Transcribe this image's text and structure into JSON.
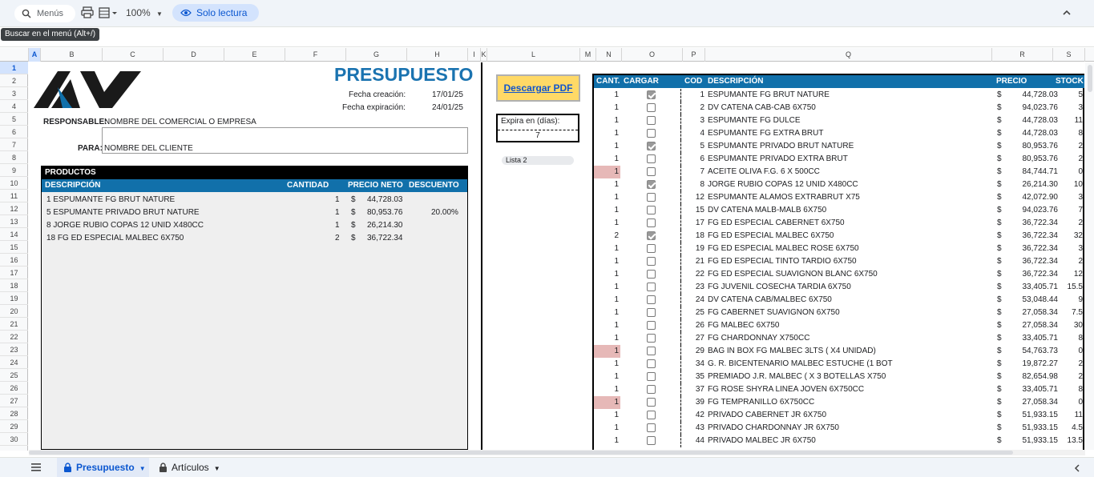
{
  "toolbar": {
    "search_placeholder": "Menús",
    "zoom": "100%",
    "readonly_label": "Solo lectura"
  },
  "tooltip": "Buscar en el menú (Alt+/)",
  "columns": [
    "A",
    "B",
    "C",
    "D",
    "E",
    "F",
    "G",
    "H",
    "I",
    "K",
    "L",
    "M",
    "N",
    "O",
    "P",
    "Q",
    "R",
    "S"
  ],
  "selected_column": "A",
  "rows": [
    "1",
    "2",
    "3",
    "4",
    "5",
    "6",
    "7",
    "8",
    "9",
    "10",
    "11",
    "12",
    "13",
    "14",
    "15",
    "16",
    "17",
    "18",
    "19",
    "20",
    "21",
    "22",
    "23",
    "24",
    "25",
    "26",
    "27",
    "28",
    "29",
    "30"
  ],
  "selected_row": "1",
  "quote": {
    "title": "PRESUPUESTO",
    "created_label": "Fecha creación:",
    "created_value": "17/01/25",
    "expires_label": "Fecha expiración:",
    "expires_value": "24/01/25",
    "responsible_label": "RESPONSABLE:",
    "responsible_value": "NOMBRE DEL COMERCIAL O EMPRESA",
    "client_label": "PARA:",
    "client_value": "NOMBRE DEL CLIENTE"
  },
  "products": {
    "section_title": "PRODUCTOS",
    "headers": {
      "desc": "DESCRIPCIÓN",
      "qty": "CANTIDAD",
      "price": "PRECIO NETO",
      "discount": "DESCUENTO"
    },
    "rows": [
      {
        "desc": "1 ESPUMANTE FG BRUT NATURE",
        "qty": "1",
        "cur": "$",
        "price": "44,728.03",
        "discount": ""
      },
      {
        "desc": "5 ESPUMANTE PRIVADO BRUT NATURE",
        "qty": "1",
        "cur": "$",
        "price": "80,953.76",
        "discount": "20.00%"
      },
      {
        "desc": "8 JORGE RUBIO COPAS 12 UNID X480CC",
        "qty": "1",
        "cur": "$",
        "price": "26,214.30",
        "discount": ""
      },
      {
        "desc": "18 FG ED ESPECIAL MALBEC 6X750",
        "qty": "2",
        "cur": "$",
        "price": "36,722.34",
        "discount": ""
      }
    ]
  },
  "pdf_button": "Descargar PDF",
  "expire": {
    "label": "Expira en (días):",
    "value": "7"
  },
  "list_select": "Lista 2",
  "catalog": {
    "headers": {
      "qty": "CANT.",
      "load": "CARGAR",
      "code": "COD",
      "desc": "DESCRIPCIÓN",
      "price": "PRECIO",
      "stock": "STOCK"
    },
    "rows": [
      {
        "qty": "1",
        "checked": true,
        "red": false,
        "code": "1",
        "desc": "ESPUMANTE FG BRUT NATURE",
        "cur": "$",
        "price": "44,728.03",
        "stock": "5"
      },
      {
        "qty": "1",
        "checked": false,
        "red": false,
        "code": "2",
        "desc": "DV CATENA CAB-CAB 6X750",
        "cur": "$",
        "price": "94,023.76",
        "stock": "3"
      },
      {
        "qty": "1",
        "checked": false,
        "red": false,
        "code": "3",
        "desc": "ESPUMANTE FG DULCE",
        "cur": "$",
        "price": "44,728.03",
        "stock": "11"
      },
      {
        "qty": "1",
        "checked": false,
        "red": false,
        "code": "4",
        "desc": "ESPUMANTE FG EXTRA BRUT",
        "cur": "$",
        "price": "44,728.03",
        "stock": "8"
      },
      {
        "qty": "1",
        "checked": true,
        "red": false,
        "code": "5",
        "desc": "ESPUMANTE PRIVADO BRUT NATURE",
        "cur": "$",
        "price": "80,953.76",
        "stock": "2"
      },
      {
        "qty": "1",
        "checked": false,
        "red": false,
        "code": "6",
        "desc": "ESPUMANTE PRIVADO EXTRA BRUT",
        "cur": "$",
        "price": "80,953.76",
        "stock": "2"
      },
      {
        "qty": "1",
        "checked": false,
        "red": true,
        "code": "7",
        "desc": "ACEITE OLIVA F.G. 6 X 500CC",
        "cur": "$",
        "price": "84,744.71",
        "stock": "0"
      },
      {
        "qty": "1",
        "checked": true,
        "red": false,
        "code": "8",
        "desc": "JORGE RUBIO COPAS 12 UNID X480CC",
        "cur": "$",
        "price": "26,214.30",
        "stock": "10"
      },
      {
        "qty": "1",
        "checked": false,
        "red": false,
        "code": "12",
        "desc": "ESPUMANTE ALAMOS EXTRABRUT X75",
        "cur": "$",
        "price": "42,072.90",
        "stock": "3"
      },
      {
        "qty": "1",
        "checked": false,
        "red": false,
        "code": "15",
        "desc": "DV CATENA MALB-MALB 6X750",
        "cur": "$",
        "price": "94,023.76",
        "stock": "7"
      },
      {
        "qty": "1",
        "checked": false,
        "red": false,
        "code": "17",
        "desc": "FG ED ESPECIAL CABERNET 6X750",
        "cur": "$",
        "price": "36,722.34",
        "stock": "2"
      },
      {
        "qty": "2",
        "checked": true,
        "red": false,
        "code": "18",
        "desc": "FG ED ESPECIAL MALBEC 6X750",
        "cur": "$",
        "price": "36,722.34",
        "stock": "32"
      },
      {
        "qty": "1",
        "checked": false,
        "red": false,
        "code": "19",
        "desc": "FG ED ESPECIAL MALBEC ROSE 6X750",
        "cur": "$",
        "price": "36,722.34",
        "stock": "3"
      },
      {
        "qty": "1",
        "checked": false,
        "red": false,
        "code": "21",
        "desc": "FG ED ESPECIAL TINTO TARDIO 6X750",
        "cur": "$",
        "price": "36,722.34",
        "stock": "2"
      },
      {
        "qty": "1",
        "checked": false,
        "red": false,
        "code": "22",
        "desc": "FG ED ESPECIAL SUAVIGNON BLANC 6X750",
        "cur": "$",
        "price": "36,722.34",
        "stock": "12"
      },
      {
        "qty": "1",
        "checked": false,
        "red": false,
        "code": "23",
        "desc": "FG JUVENIL COSECHA TARDIA 6X750",
        "cur": "$",
        "price": "33,405.71",
        "stock": "15.5"
      },
      {
        "qty": "1",
        "checked": false,
        "red": false,
        "code": "24",
        "desc": "DV CATENA CAB/MALBEC 6X750",
        "cur": "$",
        "price": "53,048.44",
        "stock": "9"
      },
      {
        "qty": "1",
        "checked": false,
        "red": false,
        "code": "25",
        "desc": "FG CABERNET SUAVIGNON 6X750",
        "cur": "$",
        "price": "27,058.34",
        "stock": "7.5"
      },
      {
        "qty": "1",
        "checked": false,
        "red": false,
        "code": "26",
        "desc": "FG MALBEC 6X750",
        "cur": "$",
        "price": "27,058.34",
        "stock": "30"
      },
      {
        "qty": "1",
        "checked": false,
        "red": false,
        "code": "27",
        "desc": "FG CHARDONNAY X750CC",
        "cur": "$",
        "price": "33,405.71",
        "stock": "8"
      },
      {
        "qty": "1",
        "checked": false,
        "red": true,
        "code": "29",
        "desc": "BAG IN BOX FG MALBEC 3LTS ( X4 UNIDAD)",
        "cur": "$",
        "price": "54,763.73",
        "stock": "0"
      },
      {
        "qty": "1",
        "checked": false,
        "red": false,
        "code": "34",
        "desc": "G. R. BICENTENARIO MALBEC ESTUCHE (1 BOT",
        "cur": "$",
        "price": "19,872.27",
        "stock": "2"
      },
      {
        "qty": "1",
        "checked": false,
        "red": false,
        "code": "35",
        "desc": "PREMIADO J.R. MALBEC ( X 3 BOTELLAS X750",
        "cur": "$",
        "price": "82,654.98",
        "stock": "2"
      },
      {
        "qty": "1",
        "checked": false,
        "red": false,
        "code": "37",
        "desc": "FG ROSE SHYRA LINEA JOVEN 6X750CC",
        "cur": "$",
        "price": "33,405.71",
        "stock": "8"
      },
      {
        "qty": "1",
        "checked": false,
        "red": true,
        "code": "39",
        "desc": "FG TEMPRANILLO 6X750CC",
        "cur": "$",
        "price": "27,058.34",
        "stock": "0"
      },
      {
        "qty": "1",
        "checked": false,
        "red": false,
        "code": "42",
        "desc": "PRIVADO CABERNET JR 6X750",
        "cur": "$",
        "price": "51,933.15",
        "stock": "11"
      },
      {
        "qty": "1",
        "checked": false,
        "red": false,
        "code": "43",
        "desc": "PRIVADO CHARDONNAY JR 6X750",
        "cur": "$",
        "price": "51,933.15",
        "stock": "4.5"
      },
      {
        "qty": "1",
        "checked": false,
        "red": false,
        "code": "44",
        "desc": "PRIVADO MALBEC JR 6X750",
        "cur": "$",
        "price": "51,933.15",
        "stock": "13.5"
      }
    ]
  },
  "sheet_tabs": [
    {
      "label": "Presupuesto",
      "active": true
    },
    {
      "label": "Artículos",
      "active": false
    }
  ],
  "colors": {
    "accent_blue": "#1170aa",
    "title_blue": "#1a73b0",
    "pdf_button": "#ffd966",
    "low_stock": "#e6b8b7"
  }
}
